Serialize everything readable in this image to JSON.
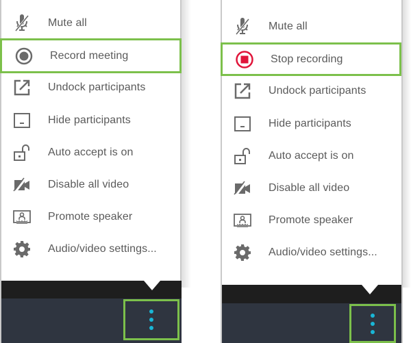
{
  "left_menu": {
    "items": [
      {
        "label": "Mute all",
        "icon": "mic-muted-icon"
      },
      {
        "label": "Record meeting",
        "icon": "record-icon",
        "highlighted": true
      },
      {
        "label": "Undock participants",
        "icon": "undock-icon"
      },
      {
        "label": "Hide participants",
        "icon": "minimize-window-icon"
      },
      {
        "label": "Auto accept is on",
        "icon": "unlock-icon"
      },
      {
        "label": "Disable all video",
        "icon": "video-off-icon"
      },
      {
        "label": "Promote speaker",
        "icon": "promote-speaker-icon"
      },
      {
        "label": "Audio/video settings...",
        "icon": "gear-icon"
      }
    ],
    "more_button_icon": "more-vertical-icon"
  },
  "right_menu": {
    "items": [
      {
        "label": "Mute all",
        "icon": "mic-muted-icon"
      },
      {
        "label": "Stop recording",
        "icon": "stop-record-icon",
        "highlighted": true
      },
      {
        "label": "Undock participants",
        "icon": "undock-icon"
      },
      {
        "label": "Hide participants",
        "icon": "minimize-window-icon"
      },
      {
        "label": "Auto accept is on",
        "icon": "unlock-icon"
      },
      {
        "label": "Disable all video",
        "icon": "video-off-icon"
      },
      {
        "label": "Promote speaker",
        "icon": "promote-speaker-icon"
      },
      {
        "label": "Audio/video settings...",
        "icon": "gear-icon"
      }
    ],
    "more_button_icon": "more-vertical-icon"
  },
  "colors": {
    "highlight_border": "#7cc04b",
    "icon_gray": "#6a6a6a",
    "stop_red": "#e0153a",
    "dots_cyan": "#19b6d6",
    "toolbar_dark": "#2f3540"
  }
}
